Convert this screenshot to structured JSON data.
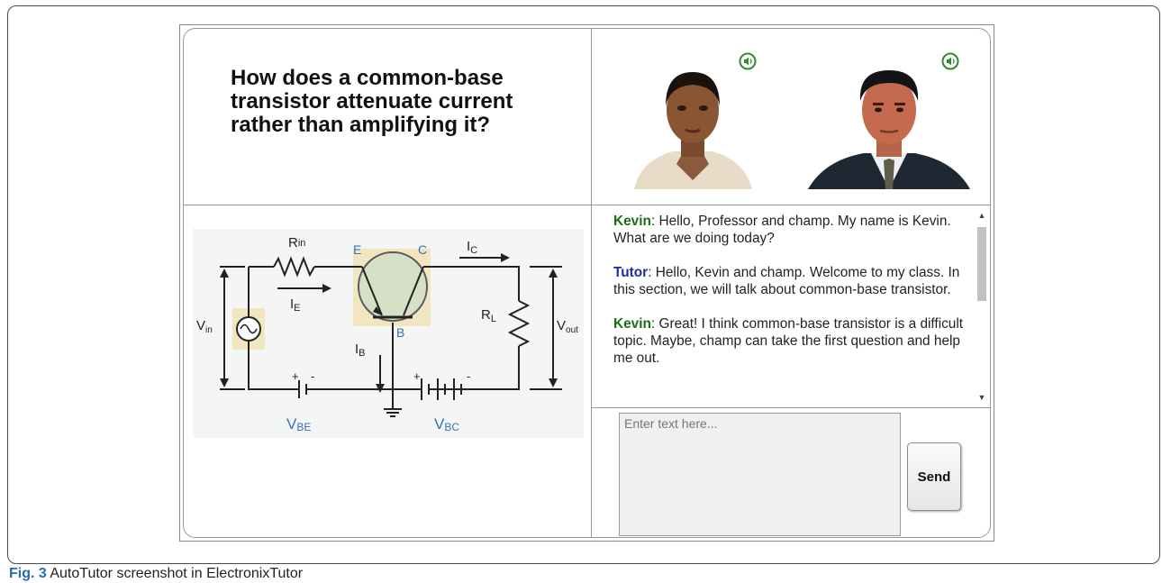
{
  "question": {
    "text": "How does a common-base transistor attenuate current rather than amplifying it?"
  },
  "avatars": [
    {
      "name": "female-agent",
      "icon": "speaker-icon"
    },
    {
      "name": "male-agent",
      "icon": "speaker-icon"
    }
  ],
  "circuit": {
    "labels": {
      "rin": "R",
      "rin_sub": "in",
      "e": "E",
      "c": "C",
      "b": "B",
      "ic": "I",
      "ic_sub": "C",
      "ie": "I",
      "ie_sub": "E",
      "ib": "I",
      "ib_sub": "B",
      "rl": "R",
      "rl_sub": "L",
      "vin": "V",
      "vin_sub": "in",
      "vout": "V",
      "vout_sub": "out",
      "vbe": "V",
      "vbe_sub": "BE",
      "vbc": "V",
      "vbc_sub": "BC",
      "plus": "+",
      "minus": "-"
    }
  },
  "chat": {
    "messages": [
      {
        "speaker": "Kevin",
        "text": ": Hello, Professor and champ. My name is Kevin. What are we doing today?"
      },
      {
        "speaker": "Tutor",
        "text": ": Hello, Kevin and champ. Welcome to my class. In this section, we will talk about common-base transistor."
      },
      {
        "speaker": "Kevin",
        "text": ": Great! I think common-base transistor is a difficult topic. Maybe, champ can take the first question and help me out."
      }
    ]
  },
  "input": {
    "placeholder": "Enter text here...",
    "send_label": "Send"
  },
  "caption": {
    "fig": "Fig. 3",
    "text": " AutoTutor screenshot in ElectronixTutor"
  },
  "colors": {
    "kevin": "#1a6e1a",
    "tutor": "#1c2fa0",
    "circuit_highlight": "#f1e6c0",
    "circuit_blue": "#3a6fb8"
  }
}
